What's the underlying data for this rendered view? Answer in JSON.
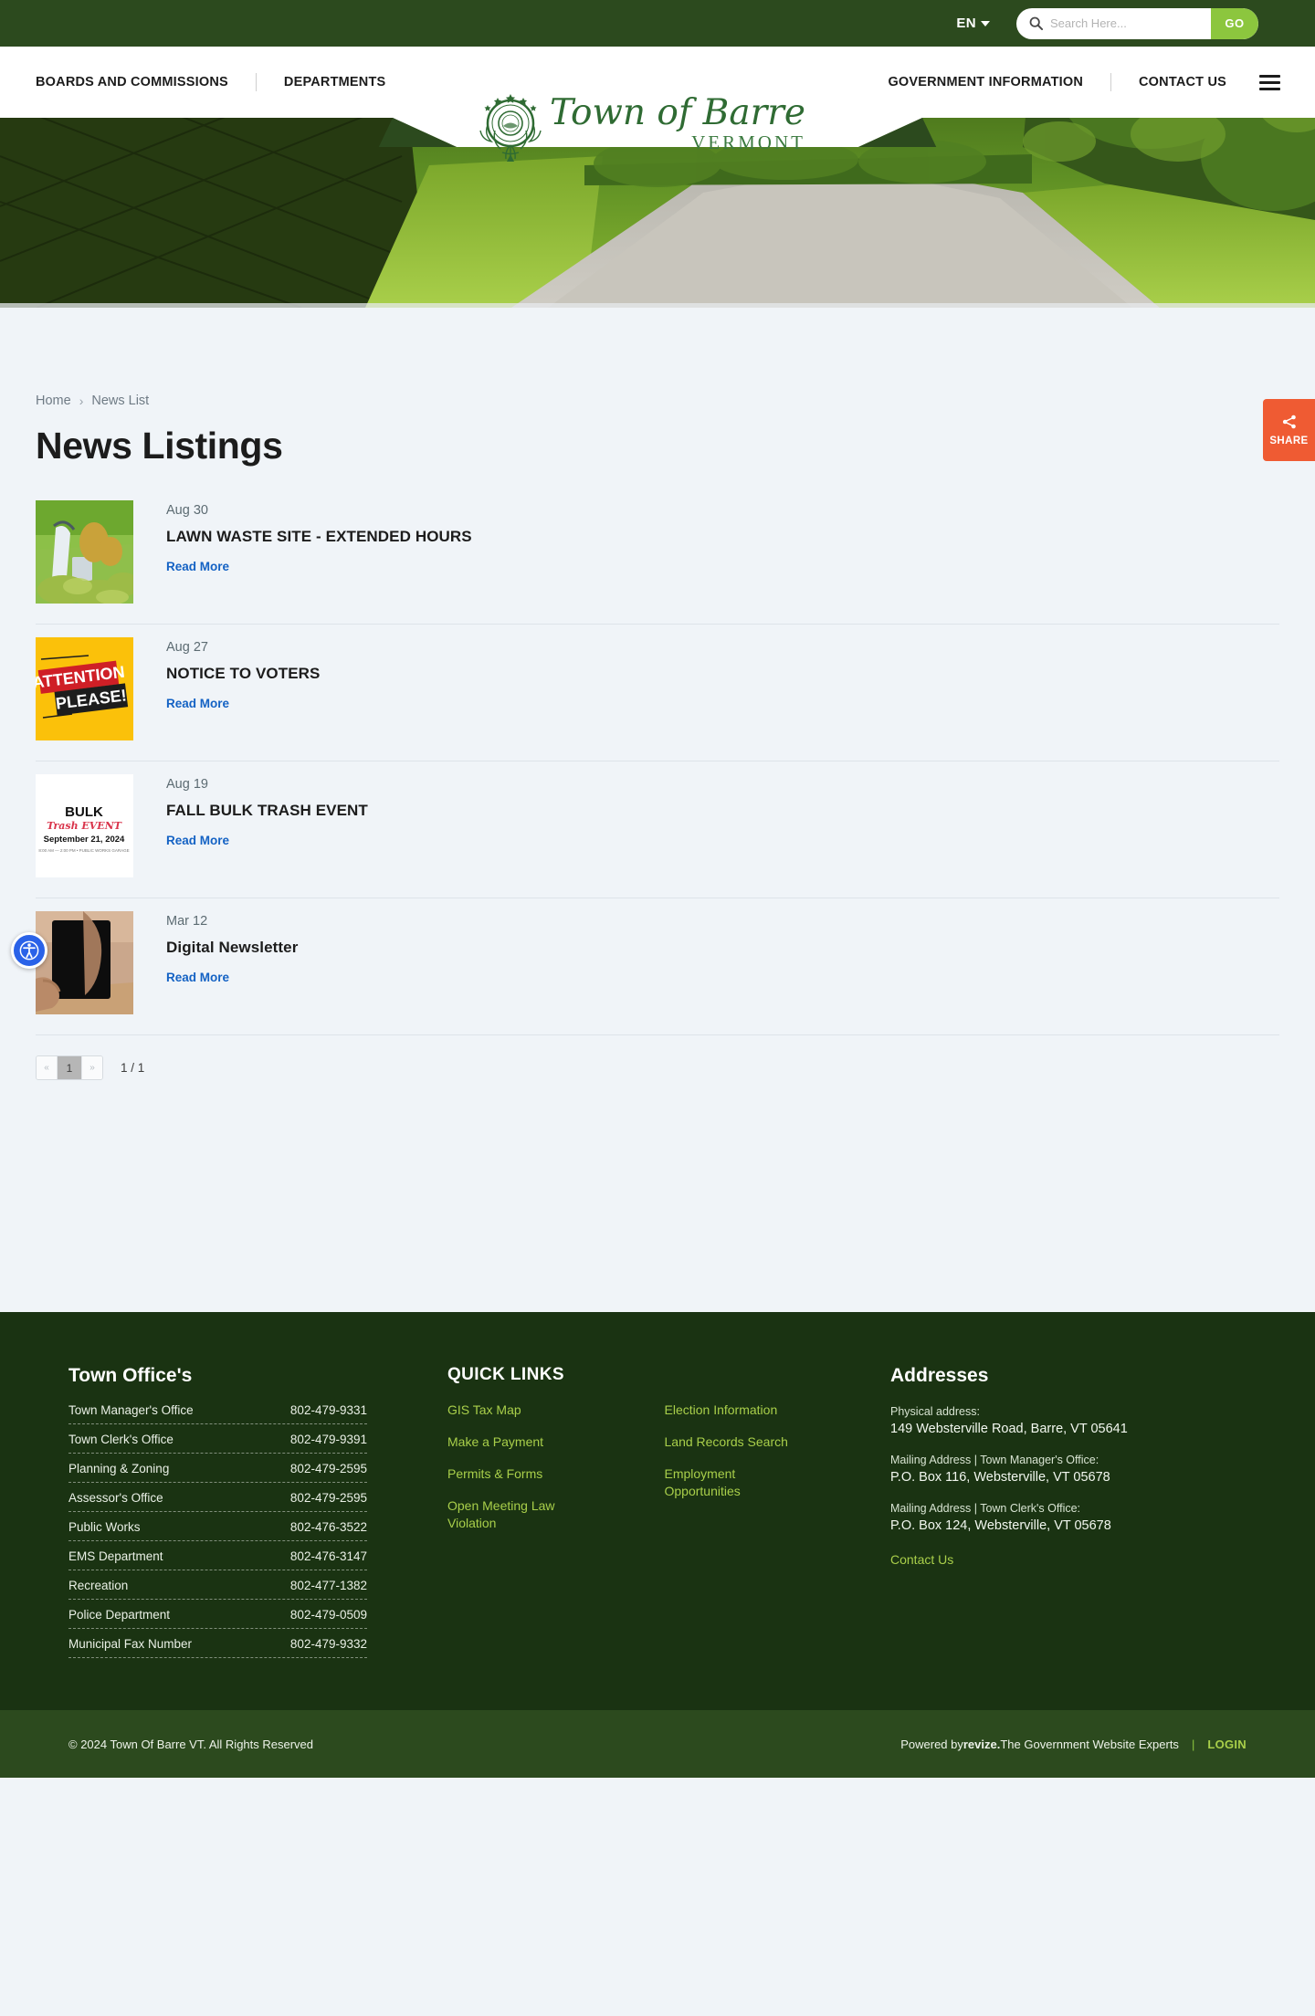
{
  "topbar": {
    "language": "EN",
    "search_placeholder": "Search Here...",
    "search_value": "",
    "go_label": "GO"
  },
  "nav": {
    "left_items": [
      {
        "label": "BOARDS AND COMMISSIONS"
      },
      {
        "label": "DEPARTMENTS"
      }
    ],
    "right_items": [
      {
        "label": "GOVERNMENT INFORMATION"
      },
      {
        "label": "CONTACT US"
      }
    ],
    "logo_script": "Town of Barre",
    "logo_sub": "VERMONT"
  },
  "share": {
    "label": "SHARE"
  },
  "breadcrumb": {
    "home": "Home",
    "separator": "›",
    "current": "News List"
  },
  "page": {
    "title": "News Listings"
  },
  "news": {
    "read_more_label": "Read More",
    "items": [
      {
        "date": "Aug 30",
        "title": "LAWN WASTE SITE - EXTENDED HOURS",
        "thumb": "lawn-waste-photo"
      },
      {
        "date": "Aug 27",
        "title": "NOTICE TO VOTERS",
        "thumb": "attention-please-graphic"
      },
      {
        "date": "Aug 19",
        "title": "FALL BULK TRASH EVENT",
        "thumb": "bulk-trash-flyer"
      },
      {
        "date": "Mar 12",
        "title": "Digital Newsletter",
        "thumb": "tablet-photo"
      }
    ]
  },
  "pagination": {
    "prev": "«",
    "next": "»",
    "current_page": "1",
    "counter": "1 / 1"
  },
  "footer": {
    "offices": {
      "heading": "Town Office's",
      "rows": [
        {
          "name": "Town Manager's Office",
          "phone": "802-479-9331"
        },
        {
          "name": "Town Clerk's Office",
          "phone": "802-479-9391"
        },
        {
          "name": "Planning & Zoning",
          "phone": "802-479-2595"
        },
        {
          "name": "Assessor's Office",
          "phone": "802-479-2595"
        },
        {
          "name": "Public Works",
          "phone": "802-476-3522"
        },
        {
          "name": "EMS Department",
          "phone": "802-476-3147"
        },
        {
          "name": "Recreation",
          "phone": "802-477-1382"
        },
        {
          "name": "Police Department",
          "phone": "802-479-0509"
        },
        {
          "name": "Municipal Fax Number",
          "phone": "802-479-9332"
        }
      ]
    },
    "quick_links": {
      "heading": "QUICK LINKS",
      "col1": [
        {
          "label": "GIS Tax Map"
        },
        {
          "label": "Make a Payment"
        },
        {
          "label": "Permits & Forms"
        },
        {
          "label": "Open Meeting Law Violation"
        }
      ],
      "col2": [
        {
          "label": "Election Information"
        },
        {
          "label": "Land Records Search"
        },
        {
          "label": "Employment Opportunities"
        }
      ]
    },
    "addresses": {
      "heading": "Addresses",
      "blocks": [
        {
          "label": "Physical address:",
          "value": "149 Websterville Road, Barre, VT 05641"
        },
        {
          "label": "Mailing Address | Town Manager's Office:",
          "value": "P.O. Box 116, Websterville, VT 05678"
        },
        {
          "label": "Mailing Address | Town Clerk's Office:",
          "value": "P.O. Box 124, Websterville, VT 05678"
        }
      ],
      "contact_label": "Contact Us"
    },
    "bottom": {
      "copyright": "© 2024 Town Of Barre VT. All Rights Reserved",
      "powered_prefix": "Powered by ",
      "powered_brand": "revize.",
      "powered_suffix": " The Government Website Experts",
      "separator": "|",
      "login_label": "LOGIN"
    }
  },
  "colors": {
    "dark_green": "#1a3312",
    "mid_green": "#2c4a1e",
    "lime": "#8cc63e",
    "link_lime": "#a9cf4a",
    "share_orange": "#ef5b33",
    "read_more_blue": "#1462c4",
    "page_bg": "#f0f4f8"
  }
}
